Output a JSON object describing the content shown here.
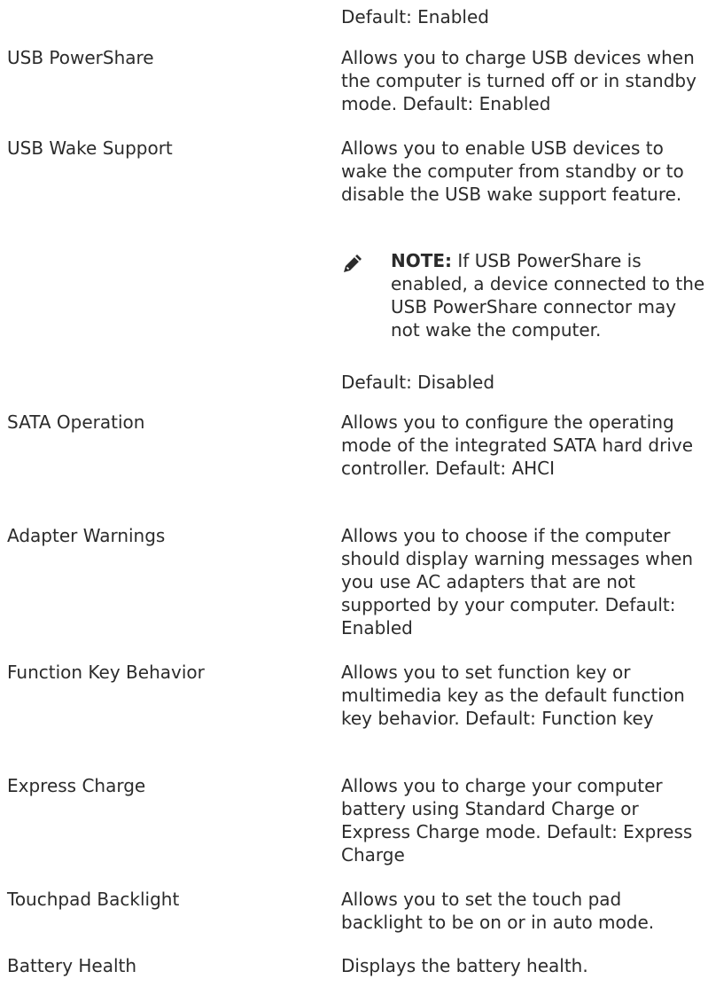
{
  "top_default": "Default: Enabled",
  "rows": [
    {
      "option": "USB PowerShare",
      "description": "Allows you to charge USB devices when the computer is turned off or in standby mode. Default: Enabled"
    },
    {
      "option": "USB Wake Support",
      "description": "Allows you to enable USB devices to wake the computer from standby or to disable the USB wake support feature.",
      "note_label": "NOTE:",
      "note_text": " If USB PowerShare is enabled, a device connected to the USB PowerShare connector may not wake the computer.",
      "default_text": "Default: Disabled"
    },
    {
      "option": "SATA Operation",
      "description": "Allows you to configure the operating mode of the integrated SATA hard drive controller. Default: AHCI"
    },
    {
      "option": "Adapter Warnings",
      "description": "Allows you to choose if the computer should display warning messages when you use AC adapters that are not supported by your computer. Default: Enabled"
    },
    {
      "option": "Function Key Behavior",
      "description": "Allows you to set function key or multimedia key as the default function key behavior. Default: Function key"
    },
    {
      "option": "Express Charge",
      "description": "Allows you to charge your computer battery using Standard Charge or Express Charge mode. Default: Express Charge"
    },
    {
      "option": "Touchpad Backlight",
      "description": "Allows you to set the touch pad backlight to be on or in auto mode."
    },
    {
      "option": "Battery Health",
      "description": "Displays the battery health."
    }
  ]
}
